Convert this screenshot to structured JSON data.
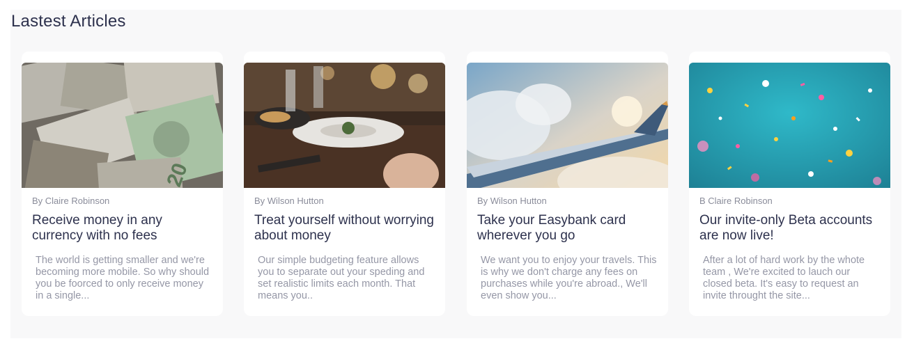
{
  "section": {
    "title": "Lastest Articles"
  },
  "articles": [
    {
      "author": "By Claire Robinson",
      "title": "Receive money in any currency with no fees",
      "excerpt": "The world is getting smaller and we're becoming more mobile. So why should you be foorced to only receive money in a single..."
    },
    {
      "author": "By Wilson Hutton",
      "title": "Treat yourself without worrying about money",
      "excerpt": "Our simple budgeting feature allows you to separate out your speding and set realistic limits each month. That means you.."
    },
    {
      "author": "By Wilson Hutton",
      "title": "Take your Easybank card wherever you go",
      "excerpt": "We want you to enjoy your travels. This is why we don't charge any fees on purchases while you're abroad., We'll even show you..."
    },
    {
      "author": "B Claire Robinson",
      "title": "Our invite-only Beta accounts are now live!",
      "excerpt": "After a lot of hard work by the whote team , We're excited to lauch our closed beta. It's easy to request an invite throught the site..."
    }
  ]
}
